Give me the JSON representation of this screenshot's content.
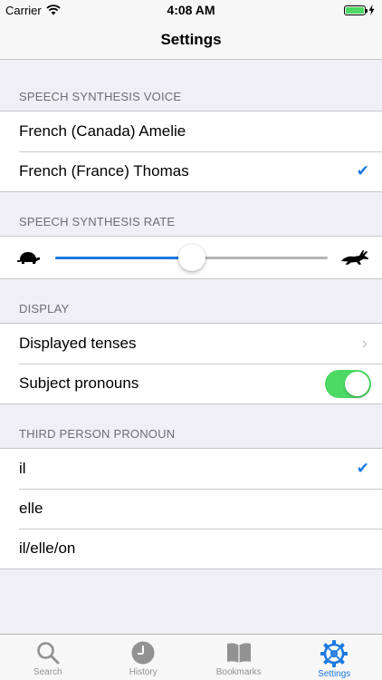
{
  "status": {
    "carrier": "Carrier",
    "time": "4:08 AM"
  },
  "nav": {
    "title": "Settings"
  },
  "voice_section": {
    "header": "SPEECH SYNTHESIS VOICE",
    "options": [
      {
        "label": "French (Canada) Amelie",
        "selected": false
      },
      {
        "label": "French (France) Thomas",
        "selected": true
      }
    ]
  },
  "rate_section": {
    "header": "SPEECH SYNTHESIS RATE",
    "rate_fraction": 0.5
  },
  "display_section": {
    "header": "DISPLAY",
    "tenses_label": "Displayed tenses",
    "pronouns_label": "Subject pronouns",
    "pronouns_on": true
  },
  "third_person_section": {
    "header": "THIRD PERSON PRONOUN",
    "options": [
      {
        "label": "il",
        "selected": true
      },
      {
        "label": "elle",
        "selected": false
      },
      {
        "label": "il/elle/on",
        "selected": false
      }
    ]
  },
  "tabs": [
    {
      "label": "Search",
      "icon": "search-icon",
      "active": false
    },
    {
      "label": "History",
      "icon": "clock-icon",
      "active": false
    },
    {
      "label": "Bookmarks",
      "icon": "book-icon",
      "active": false
    },
    {
      "label": "Settings",
      "icon": "gear-icon",
      "active": true
    }
  ],
  "colors": {
    "accent": "#1a7ae0",
    "toggle_on": "#4cd964",
    "inactive_tab": "#929292"
  }
}
